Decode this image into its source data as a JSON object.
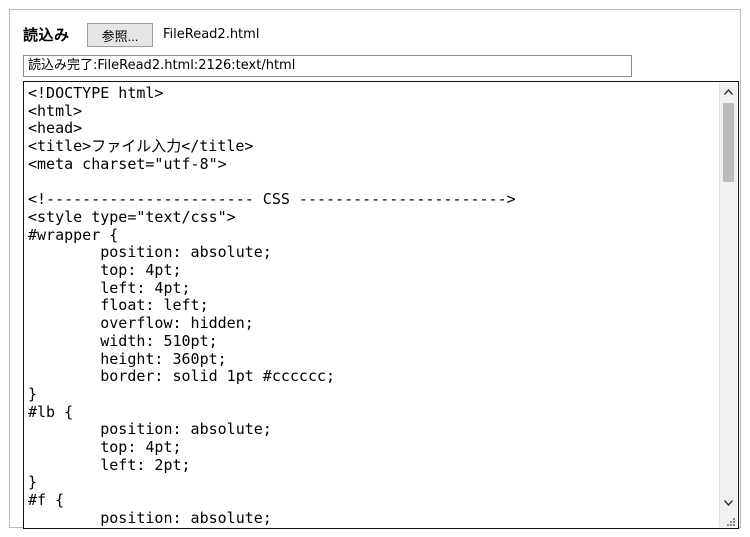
{
  "toolbar": {
    "read_label": "読込み",
    "browse_label": "参照...",
    "file_name": "FileRead2.html"
  },
  "status": {
    "prefix": "読込み完了",
    "detail": ":FileRead2.html:2126:text/html"
  },
  "editor": {
    "content": "<!DOCTYPE html>\n<html>\n<head>\n<title>ファイル入力</title>\n<meta charset=\"utf-8\">\n\n<!----------------------- CSS ----------------------->\n<style type=\"text/css\">\n#wrapper {\n\tposition: absolute;\n\ttop: 4pt;\n\tleft: 4pt;\n\tfloat: left;\n\toverflow: hidden;\n\twidth: 510pt;\n\theight: 360pt;\n\tborder: solid 1pt #cccccc;\n}\n#lb {\n\tposition: absolute;\n\ttop: 4pt;\n\tleft: 2pt;\n}\n#f {\n\tposition: absolute;"
  },
  "scrollbar": {
    "up_icon": "▲",
    "down_icon": "▼"
  }
}
